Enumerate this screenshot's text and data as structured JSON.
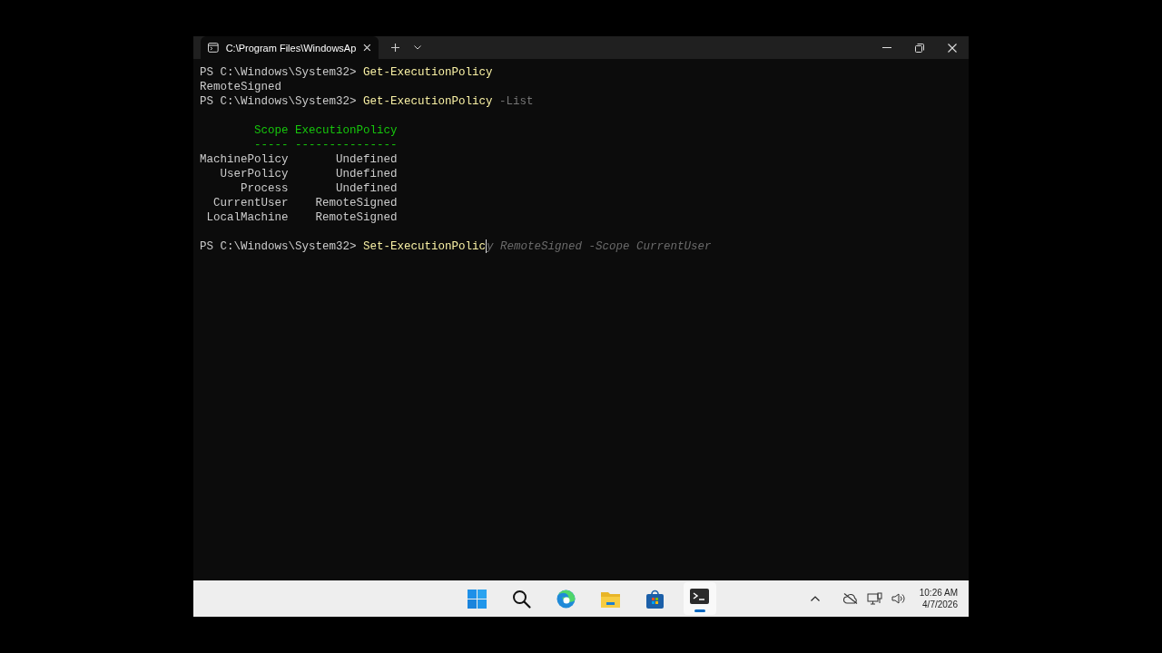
{
  "tab": {
    "title": "C:\\Program Files\\WindowsAp",
    "selected": true
  },
  "console": {
    "lines": [
      {
        "kind": "command",
        "prompt": "PS C:\\Windows\\System32>",
        "command": "Get-ExecutionPolicy"
      },
      {
        "kind": "output",
        "text": "RemoteSigned"
      },
      {
        "kind": "command",
        "prompt": "PS C:\\Windows\\System32>",
        "command": "Get-ExecutionPolicy",
        "parameter": "-List"
      },
      {
        "kind": "blank"
      },
      {
        "kind": "table",
        "columns": [
          "Scope",
          "ExecutionPolicy"
        ],
        "rules": [
          "-----",
          "---------------"
        ],
        "rows": [
          [
            "MachinePolicy",
            "Undefined"
          ],
          [
            "UserPolicy",
            "Undefined"
          ],
          [
            "Process",
            "Undefined"
          ],
          [
            "CurrentUser",
            "RemoteSigned"
          ],
          [
            "LocalMachine",
            "RemoteSigned"
          ]
        ]
      },
      {
        "kind": "blank"
      },
      {
        "kind": "input",
        "prompt": "PS C:\\Windows\\System32>",
        "command": "Set-ExecutionPolic",
        "suggestion": "y RemoteSigned -Scope CurrentUser"
      }
    ]
  },
  "taskbar": {
    "apps": [
      {
        "kind": "start",
        "active": false
      },
      {
        "kind": "search",
        "active": false
      },
      {
        "kind": "browser",
        "active": false
      },
      {
        "kind": "folder",
        "active": false
      },
      {
        "kind": "store",
        "active": false
      },
      {
        "kind": "terminal",
        "active": true
      }
    ],
    "time": "10:26 AM",
    "date": "4/7/2026"
  }
}
